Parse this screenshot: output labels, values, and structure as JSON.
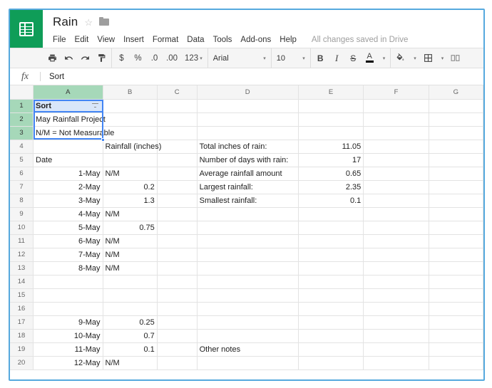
{
  "app": {
    "logo_icon": "sheets-grid-icon",
    "doc_title": "Rain",
    "star_icon": "star-outline-icon",
    "folder_icon": "folder-icon",
    "save_status": "All changes saved in Drive"
  },
  "menubar": {
    "items": [
      {
        "label": "File"
      },
      {
        "label": "Edit"
      },
      {
        "label": "View"
      },
      {
        "label": "Insert"
      },
      {
        "label": "Format"
      },
      {
        "label": "Data"
      },
      {
        "label": "Tools"
      },
      {
        "label": "Add-ons"
      },
      {
        "label": "Help"
      }
    ]
  },
  "toolbar": {
    "print_icon": "print-icon",
    "undo_icon": "undo-icon",
    "redo_icon": "redo-icon",
    "paint_format_icon": "paint-format-icon",
    "currency_label": "$",
    "percent_label": "%",
    "decrease_decimal_label": ".0",
    "increase_decimal_label": ".00",
    "number_format_label": "123",
    "font_name": "Arial",
    "font_size": "10",
    "bold_label": "B",
    "italic_label": "I",
    "strikethrough_label": "S",
    "text_color_label": "A",
    "fill_color_icon": "fill-color-icon",
    "borders_icon": "borders-icon",
    "merge_cells_icon": "merge-cells-icon",
    "caret": "▾"
  },
  "formula_bar": {
    "fx_label": "fx",
    "value": "Sort"
  },
  "grid": {
    "columns": [
      "A",
      "B",
      "C",
      "D",
      "E",
      "F",
      "G"
    ],
    "selected_columns": [
      "A"
    ],
    "selected_rows": [
      1,
      2,
      3
    ],
    "a1_filter_icon": "filter-icon",
    "rows": [
      {
        "n": "1",
        "A": "Sort",
        "B": "",
        "C": "",
        "D": "",
        "E": "",
        "F": "",
        "G": ""
      },
      {
        "n": "2",
        "A": "May Rainfall Project",
        "B": "",
        "C": "",
        "D": "",
        "E": "",
        "F": "",
        "G": ""
      },
      {
        "n": "3",
        "A": "N/M = Not Measurable",
        "B": "",
        "C": "",
        "D": "",
        "E": "",
        "F": "",
        "G": ""
      },
      {
        "n": "4",
        "A": "",
        "B": "Rainfall (inches)",
        "C": "",
        "D": "Total inches of rain:",
        "E": "11.05",
        "F": "",
        "G": ""
      },
      {
        "n": "5",
        "A": "Date",
        "B": "",
        "C": "",
        "D": "Number of days with rain:",
        "E": "17",
        "F": "",
        "G": ""
      },
      {
        "n": "6",
        "A": "1-May",
        "B": "N/M",
        "C": "",
        "D": "Average rainfall amount",
        "E": "0.65",
        "F": "",
        "G": ""
      },
      {
        "n": "7",
        "A": "2-May",
        "B": "0.2",
        "C": "",
        "D": "Largest rainfall:",
        "E": "2.35",
        "F": "",
        "G": ""
      },
      {
        "n": "8",
        "A": "3-May",
        "B": "1.3",
        "C": "",
        "D": "Smallest rainfall:",
        "E": "0.1",
        "F": "",
        "G": ""
      },
      {
        "n": "9",
        "A": "4-May",
        "B": "N/M",
        "C": "",
        "D": "",
        "E": "",
        "F": "",
        "G": ""
      },
      {
        "n": "10",
        "A": "5-May",
        "B": "0.75",
        "C": "",
        "D": "",
        "E": "",
        "F": "",
        "G": ""
      },
      {
        "n": "11",
        "A": "6-May",
        "B": "N/M",
        "C": "",
        "D": "",
        "E": "",
        "F": "",
        "G": ""
      },
      {
        "n": "12",
        "A": "7-May",
        "B": "N/M",
        "C": "",
        "D": "",
        "E": "",
        "F": "",
        "G": ""
      },
      {
        "n": "13",
        "A": "8-May",
        "B": "N/M",
        "C": "",
        "D": "",
        "E": "",
        "F": "",
        "G": ""
      },
      {
        "n": "14",
        "A": "",
        "B": "",
        "C": "",
        "D": "",
        "E": "",
        "F": "",
        "G": ""
      },
      {
        "n": "15",
        "A": "",
        "B": "",
        "C": "",
        "D": "",
        "E": "",
        "F": "",
        "G": ""
      },
      {
        "n": "16",
        "A": "",
        "B": "",
        "C": "",
        "D": "",
        "E": "",
        "F": "",
        "G": ""
      },
      {
        "n": "17",
        "A": "9-May",
        "B": "0.25",
        "C": "",
        "D": "",
        "E": "",
        "F": "",
        "G": ""
      },
      {
        "n": "18",
        "A": "10-May",
        "B": "0.7",
        "C": "",
        "D": "",
        "E": "",
        "F": "",
        "G": ""
      },
      {
        "n": "19",
        "A": "11-May",
        "B": "0.1",
        "C": "",
        "D": "Other notes",
        "E": "",
        "F": "",
        "G": ""
      },
      {
        "n": "20",
        "A": "12-May",
        "B": "N/M",
        "C": "",
        "D": "",
        "E": "",
        "F": "",
        "G": ""
      }
    ]
  },
  "colors": {
    "brand_green": "#0f9d58",
    "selection_blue": "#4285f4",
    "header_selected_green": "#a6d8b9",
    "frame_blue": "#56a9de"
  }
}
